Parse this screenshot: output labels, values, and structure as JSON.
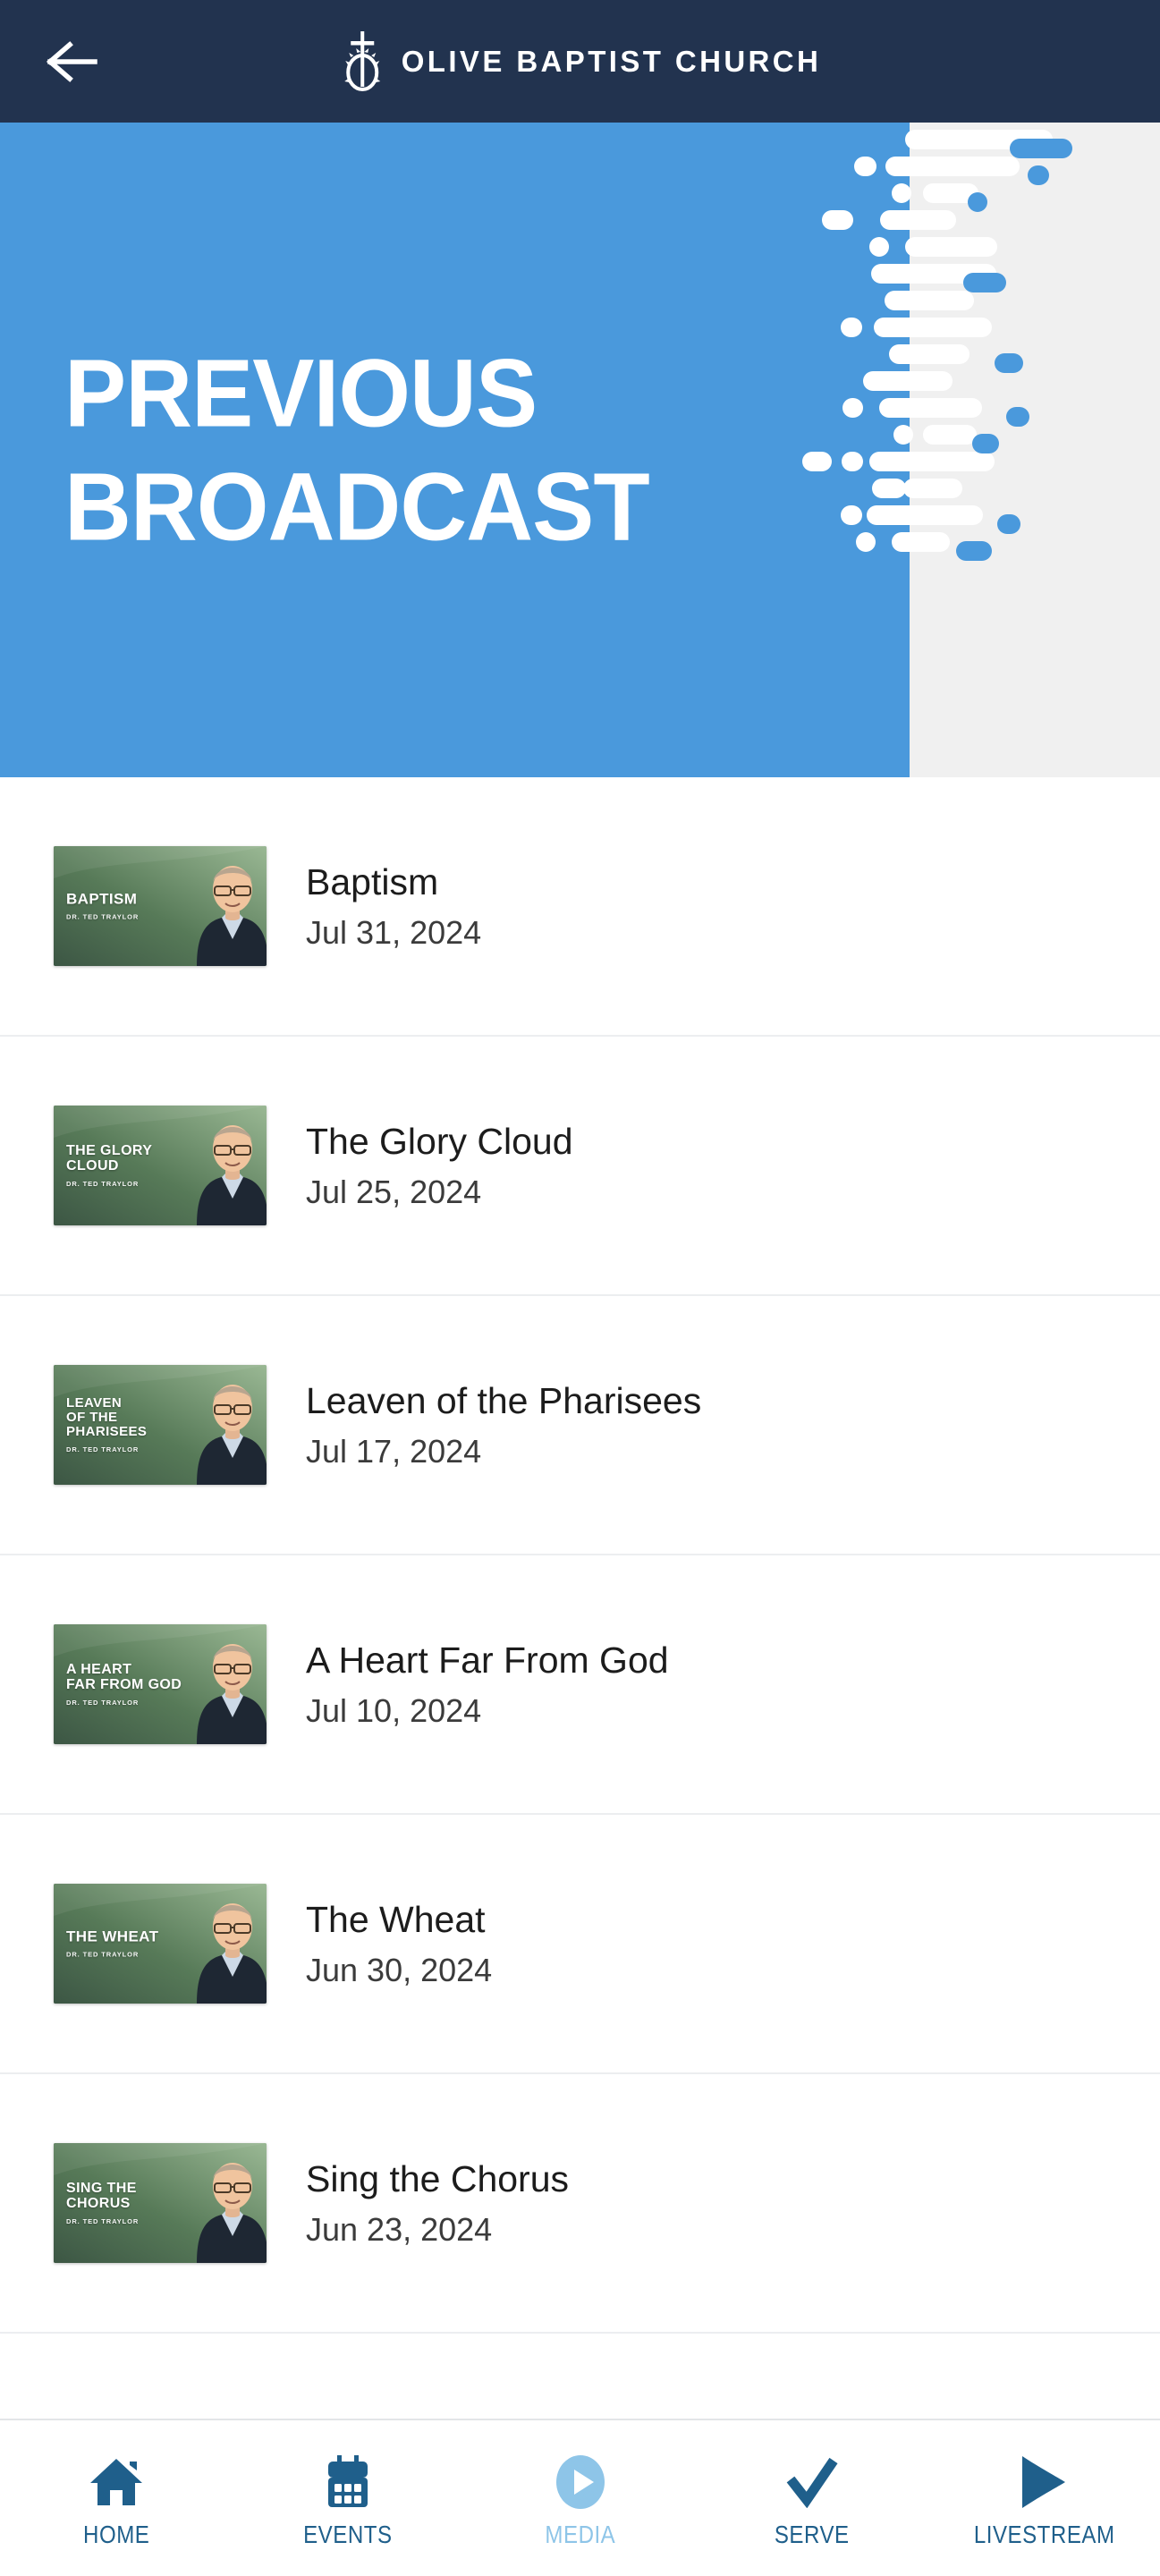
{
  "header": {
    "back_icon": "arrow-left-icon",
    "logo_icon": "cross-crown-logo-icon",
    "title": "OLIVE BAPTIST CHURCH",
    "background_color": "#22334f"
  },
  "hero": {
    "line1": "PREVIOUS",
    "line2": "BROADCAST",
    "background_color": "#4a99dc",
    "text_color": "#ffffff",
    "pattern_name": "dot-dash-stream-pattern"
  },
  "broadcasts": [
    {
      "title": "Baptism",
      "date": "Jul 31, 2024",
      "thumbnail": {
        "lines": [
          "BAPTISM"
        ],
        "speaker": "DR. TED TRAYLOR"
      }
    },
    {
      "title": "The Glory Cloud",
      "date": "Jul 25, 2024",
      "thumbnail": {
        "lines": [
          "THE GLORY",
          "CLOUD"
        ],
        "speaker": "DR. TED TRAYLOR"
      }
    },
    {
      "title": "Leaven of the Pharisees",
      "date": "Jul 17, 2024",
      "thumbnail": {
        "lines": [
          "LEAVEN",
          "OF THE",
          "PHARISEES"
        ],
        "speaker": "DR. TED TRAYLOR"
      }
    },
    {
      "title": "A Heart Far From God",
      "date": "Jul 10, 2024",
      "thumbnail": {
        "lines": [
          "A HEART",
          "FAR FROM GOD"
        ],
        "speaker": "DR. TED TRAYLOR"
      }
    },
    {
      "title": "The Wheat",
      "date": "Jun 30, 2024",
      "thumbnail": {
        "lines": [
          "THE WHEAT"
        ],
        "speaker": "DR. TED TRAYLOR"
      }
    },
    {
      "title": "Sing the Chorus",
      "date": "Jun 23, 2024",
      "thumbnail": {
        "lines": [
          "SING THE",
          "CHORUS"
        ],
        "speaker": "DR. TED TRAYLOR"
      }
    }
  ],
  "tabbar": {
    "active_tab": "MEDIA",
    "active_color": "#8ec5e8",
    "inactive_color": "#1f5f8b",
    "items": [
      {
        "label": "HOME",
        "icon": "home-icon"
      },
      {
        "label": "EVENTS",
        "icon": "calendar-icon"
      },
      {
        "label": "MEDIA",
        "icon": "play-circle-icon"
      },
      {
        "label": "SERVE",
        "icon": "check-icon"
      },
      {
        "label": "LIVESTREAM",
        "icon": "play-triangle-icon"
      }
    ]
  }
}
